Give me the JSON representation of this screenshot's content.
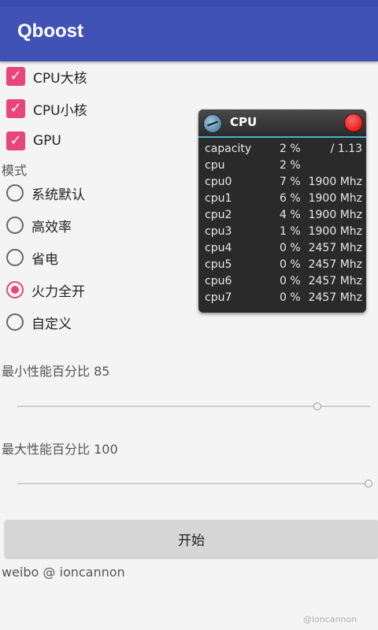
{
  "app": {
    "title": "Qboost"
  },
  "checkboxes": [
    {
      "label": "CPU大核",
      "checked": true
    },
    {
      "label": "CPU小核",
      "checked": true
    },
    {
      "label": "GPU",
      "checked": true
    }
  ],
  "mode": {
    "label": "模式",
    "options": [
      {
        "label": "系统默认",
        "selected": false
      },
      {
        "label": "高效率",
        "selected": false
      },
      {
        "label": "省电",
        "selected": false
      },
      {
        "label": "火力全开",
        "selected": true
      },
      {
        "label": "自定义",
        "selected": false
      }
    ]
  },
  "sliders": {
    "min": {
      "label": "最小性能百分比 85",
      "value_percent": 85
    },
    "max": {
      "label": "最大性能百分比 100",
      "value_percent": 100
    }
  },
  "start_button": {
    "label": "开始"
  },
  "footer": {
    "text": "weibo @ ioncannon"
  },
  "watermark": {
    "text": "@ioncannon"
  },
  "cpu_widget": {
    "title": "CPU",
    "rows": [
      {
        "name": "capacity",
        "percent": "2 %",
        "freq": "/ 1.13"
      },
      {
        "name": "cpu",
        "percent": "2 %",
        "freq": ""
      },
      {
        "name": "cpu0",
        "percent": "7 %",
        "freq": "1900 Mhz"
      },
      {
        "name": "cpu1",
        "percent": "6 %",
        "freq": "1900 Mhz"
      },
      {
        "name": "cpu2",
        "percent": "4 %",
        "freq": "1900 Mhz"
      },
      {
        "name": "cpu3",
        "percent": "1 %",
        "freq": "1900 Mhz"
      },
      {
        "name": "cpu4",
        "percent": "0 %",
        "freq": "2457 Mhz"
      },
      {
        "name": "cpu5",
        "percent": "0 %",
        "freq": "2457 Mhz"
      },
      {
        "name": "cpu6",
        "percent": "0 %",
        "freq": "2457 Mhz"
      },
      {
        "name": "cpu7",
        "percent": "0 %",
        "freq": "2457 Mhz"
      }
    ]
  },
  "colors": {
    "primary": "#4152b6",
    "accent": "#e9457a",
    "background": "#f4f4f4",
    "widget_bg": "#2a2a2a"
  }
}
